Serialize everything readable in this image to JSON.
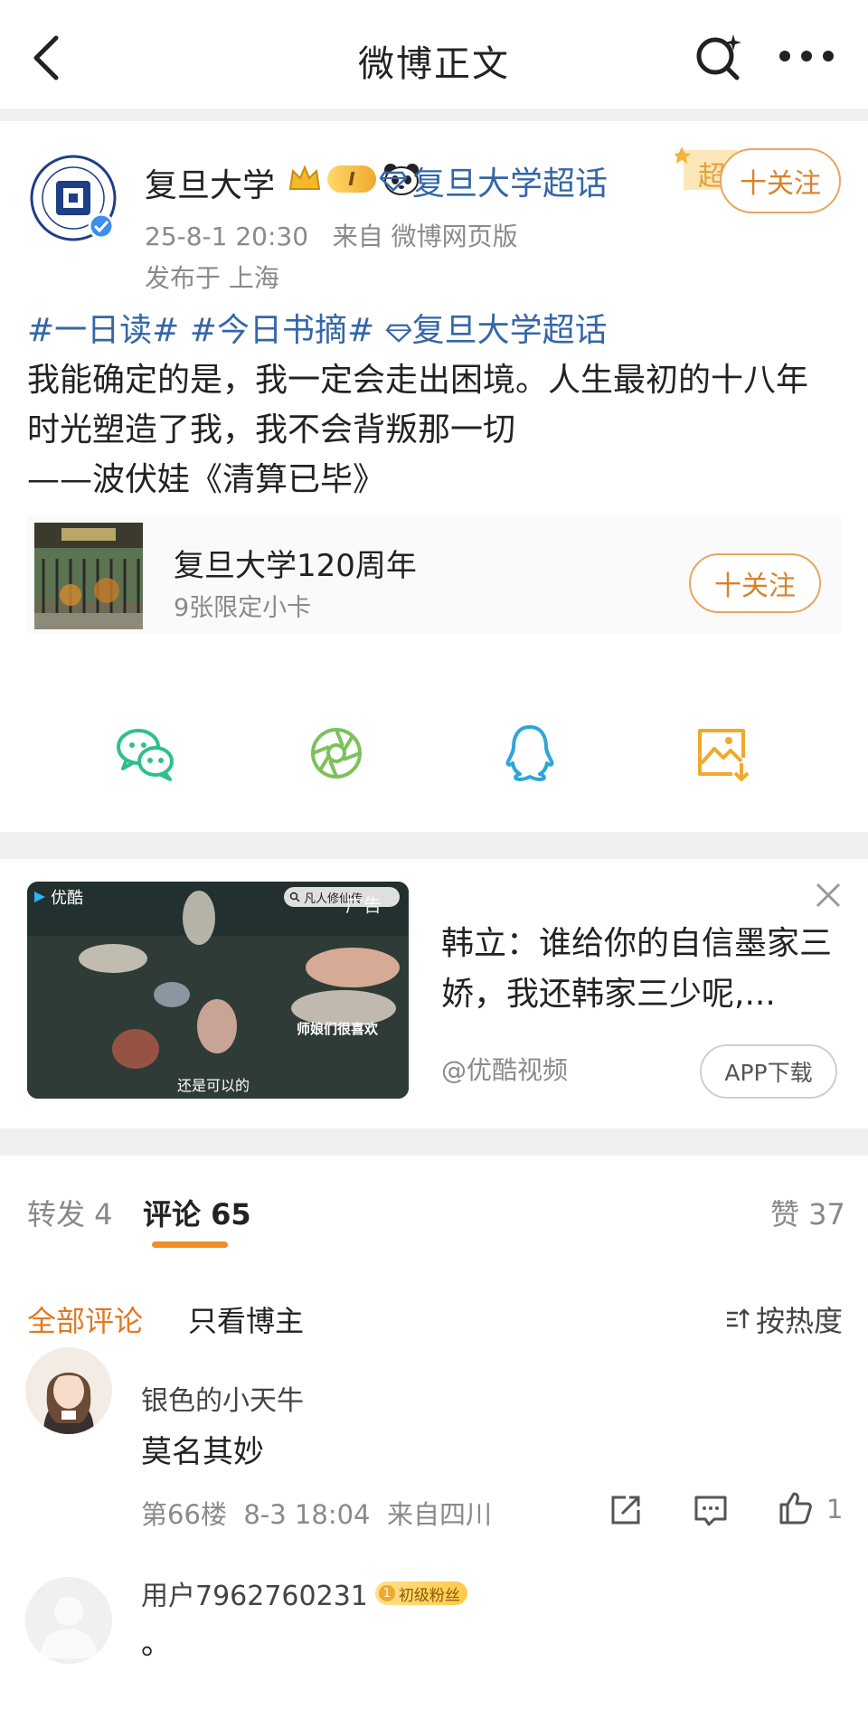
{
  "nav": {
    "title": "微博正文"
  },
  "post": {
    "author": "复旦大学",
    "vip_level": "I",
    "super_topic": "复旦大学超话",
    "ribbon_char": "超",
    "follow_label": "十关注",
    "time": "25-8-1 20:30",
    "source": "来自 微博网页版",
    "location": "发布于 上海",
    "tags": [
      "#一日读#",
      "#今日书摘#",
      "复旦大学超话"
    ],
    "lines": [
      "我能确定的是，我一定会走出困境。人生最初的十八年",
      "时光塑造了我，我不会背叛那一切",
      "——波伏娃《清算已毕》"
    ],
    "card": {
      "title": "复旦大学120周年",
      "subtitle": "9张限定小卡",
      "follow_label": "十关注"
    },
    "share_icons": [
      "wechat-icon",
      "moments-icon",
      "qq-icon",
      "save-image-icon"
    ]
  },
  "ad": {
    "brand": "优酷",
    "search_chip": "凡人修仙传",
    "tag": "广告",
    "caption_1": "师娘们很喜欢",
    "caption_2": "还是可以的",
    "title": "韩立：谁给你的自信墨家三娇，我还韩家三少呢,...",
    "source": "@优酷视频",
    "button": "APP下载"
  },
  "tabs": {
    "repost": "转发 4",
    "comments": "评论 65",
    "likes": "赞 37"
  },
  "filters": {
    "all": "全部评论",
    "author_only": "只看博主",
    "sort": "按热度"
  },
  "comments": [
    {
      "name": "银色的小天牛",
      "text": "莫名其妙",
      "floor": "第66楼",
      "time": "8-3 18:04",
      "region": "来自四川",
      "likes": "1"
    },
    {
      "name": "用户7962760231",
      "badge": "初级粉丝",
      "badge_level": "1",
      "text": "。"
    }
  ],
  "colors": {
    "accent": "#f08c2a",
    "link": "#3566a8",
    "follow": "#d9822b",
    "muted": "#8a8a8a"
  }
}
